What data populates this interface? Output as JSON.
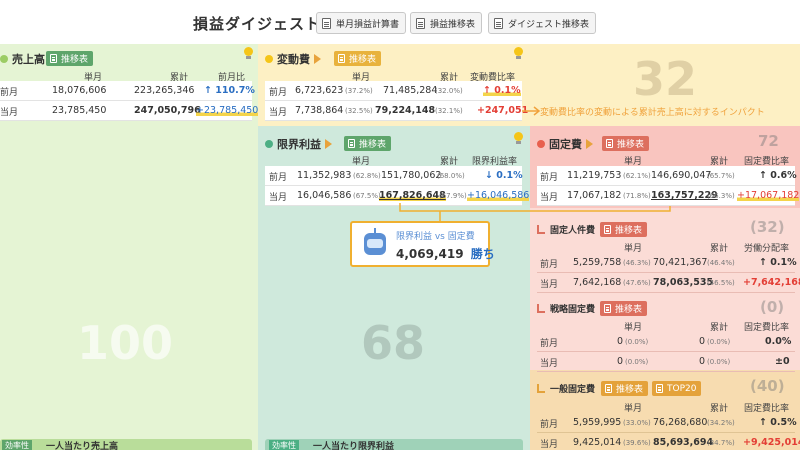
{
  "header": {
    "title": "損益ダイジェスト",
    "buttons": [
      "単月損益計算書",
      "損益推移表",
      "ダイジェスト推移表"
    ]
  },
  "colors": {
    "sales_bg": "#e5f4d4",
    "var_bg": "#fdf0c4",
    "margin_bg": "#cfe9dc",
    "fixed_bg": "#f9c5bf",
    "general_bg": "#f7dcb0",
    "up_red": "#e33e35",
    "blue": "#2a6ec2"
  },
  "icons": [
    "document-icon",
    "lightbulb-icon",
    "play-arrow-icon",
    "robot-icon",
    "up-arrow-icon",
    "down-arrow-icon"
  ],
  "sales": {
    "title": "売上高",
    "chip": "推移表",
    "big": "100",
    "headers": [
      "単月",
      "累計",
      "前月比"
    ],
    "prev": {
      "label": "前月",
      "m": "18,076,606",
      "c": "223,265,346",
      "r": "↑ 110.7%"
    },
    "cur": {
      "label": "当月",
      "m": "23,785,450",
      "c": "247,050,796",
      "r": "+23,785,450"
    },
    "bottom_label": "一人当たり売上高"
  },
  "variable": {
    "title": "変動費",
    "chip": "推移表",
    "big": "32",
    "headers": [
      "単月",
      "累計",
      "変動費比率"
    ],
    "prev": {
      "label": "前月",
      "m": "6,723,623",
      "mp": "(37.2%)",
      "c": "71,485,284",
      "cp": "(32.0%)",
      "r": "↑ 0.1%"
    },
    "cur": {
      "label": "当月",
      "m": "7,738,864",
      "mp": "(32.5%)",
      "c": "79,224,148",
      "cp": "(32.1%)",
      "r": "+247,051"
    },
    "impact": "変動費比率の変動による累計売上高に対するインパクト"
  },
  "margin": {
    "title": "限界利益",
    "chip": "推移表",
    "big": "68",
    "headers": [
      "単月",
      "累計",
      "限界利益率"
    ],
    "prev": {
      "label": "前月",
      "m": "11,352,983",
      "mp": "(62.8%)",
      "c": "151,780,062",
      "cp": "(68.0%)",
      "r": "↓ 0.1%"
    },
    "cur": {
      "label": "当月",
      "m": "16,046,586",
      "mp": "(67.5%)",
      "c": "167,826,648",
      "cp": "(67.9%)",
      "r": "+16,046,586"
    },
    "callout_title": "限界利益 vs 固定費",
    "callout_value": "4,069,419",
    "callout_win": "勝ち",
    "bottom_label": "一人当たり限界利益"
  },
  "fixed": {
    "title": "固定費",
    "chip": "推移表",
    "big": "72",
    "headers": [
      "単月",
      "累計",
      "固定費比率"
    ],
    "prev": {
      "label": "前月",
      "m": "11,219,753",
      "mp": "(62.1%)",
      "c": "146,690,047",
      "cp": "(65.7%)",
      "r": "↑ 0.6%"
    },
    "cur": {
      "label": "当月",
      "m": "17,067,182",
      "mp": "(71.8%)",
      "c": "163,757,229",
      "cp": "(66.3%)",
      "r": "+17,067,182"
    }
  },
  "personnel": {
    "title": "固定人件費",
    "chip": "推移表",
    "big": "(32)",
    "headers": [
      "単月",
      "累計",
      "労働分配率"
    ],
    "prev": {
      "label": "前月",
      "m": "5,259,758",
      "mp": "(46.3%)",
      "c": "70,421,367",
      "cp": "(46.4%)",
      "r": "↑ 0.1%"
    },
    "cur": {
      "label": "当月",
      "m": "7,642,168",
      "mp": "(47.6%)",
      "c": "78,063,535",
      "cp": "(46.5%)",
      "r": "+7,642,168"
    }
  },
  "strategic": {
    "title": "戦略固定費",
    "chip": "推移表",
    "big": "(0)",
    "headers": [
      "単月",
      "累計",
      "固定費比率"
    ],
    "prev": {
      "label": "前月",
      "m": "0",
      "mp": "(0.0%)",
      "c": "0",
      "cp": "(0.0%)",
      "r": "0.0%"
    },
    "cur": {
      "label": "当月",
      "m": "0",
      "mp": "(0.0%)",
      "c": "0",
      "cp": "(0.0%)",
      "r": "±0"
    }
  },
  "general": {
    "title": "一般固定費",
    "chip": "推移表",
    "chip2": "TOP20",
    "big": "(40)",
    "headers": [
      "単月",
      "累計",
      "固定費比率"
    ],
    "prev": {
      "label": "前月",
      "m": "5,959,995",
      "mp": "(33.0%)",
      "c": "76,268,680",
      "cp": "(34.2%)",
      "r": "↑ 0.5%"
    },
    "cur": {
      "label": "当月",
      "m": "9,425,014",
      "mp": "(39.6%)",
      "c": "85,693,694",
      "cp": "(34.7%)",
      "r": "+9,425,014"
    }
  },
  "bottom_chip": "効率性"
}
